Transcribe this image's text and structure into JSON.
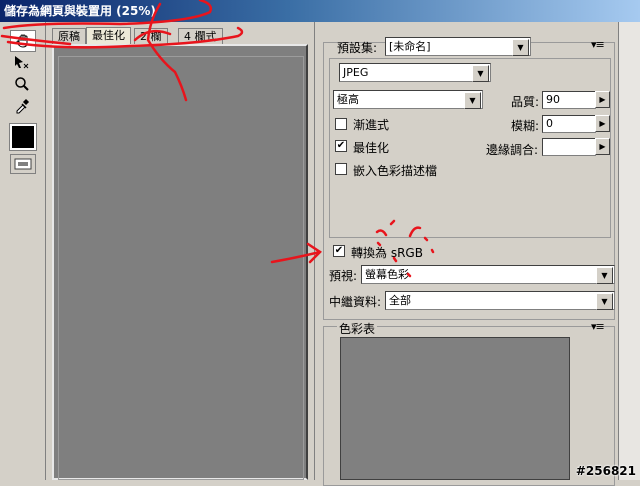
{
  "window": {
    "title": "儲存為網頁與裝置用 (25%)"
  },
  "tabs": [
    {
      "label": "原稿"
    },
    {
      "label": "最佳化"
    },
    {
      "label": "2 欄"
    },
    {
      "label": "4 欄式"
    }
  ],
  "tools": [
    "hand-icon",
    "slice-select-icon",
    "zoom-icon",
    "eyedropper-icon",
    "eyedropper-color-icon",
    "toggle-slices-icon"
  ],
  "settings": {
    "preset_label": "預設集:",
    "preset_value": "[未命名]",
    "format_value": "JPEG",
    "quality_preset": "極高",
    "quality_label": "品質:",
    "quality_value": "90",
    "progressive_label": "漸進式",
    "progressive_checked": false,
    "blur_label": "模糊:",
    "blur_value": "0",
    "optimized_label": "最佳化",
    "optimized_checked": true,
    "matte_label": "邊緣調合:",
    "matte_value": "",
    "embed_profile_label": "嵌入色彩描述檔",
    "embed_profile_checked": false,
    "convert_srgb_label": "轉換為 sRGB",
    "convert_srgb_checked": true,
    "preview_label": "預視:",
    "preview_value": "螢幕色彩",
    "metadata_label": "中繼資料:",
    "metadata_value": "全部"
  },
  "color_table": {
    "title": "色彩表"
  },
  "watermark": "#256821",
  "annotation_color": "#e8141c"
}
